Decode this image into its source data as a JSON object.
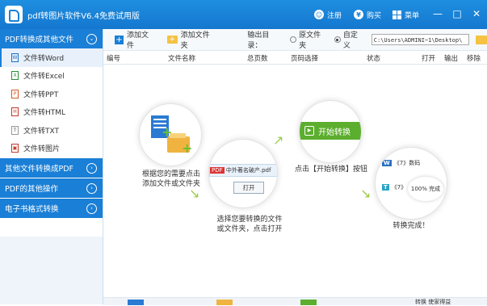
{
  "app": {
    "title": "pdf转图片软件V6.4免费试用版"
  },
  "titlebar": {
    "register": "注册",
    "buy": "购买",
    "menu": "菜单",
    "minimize": "—",
    "maximize": "□",
    "close": "✕"
  },
  "sidebar": {
    "section_title": "PDF转换成其他文件",
    "items": [
      {
        "label": "文件转Word",
        "icon": "W"
      },
      {
        "label": "文件转Excel",
        "icon": "X"
      },
      {
        "label": "文件转PPT",
        "icon": "P"
      },
      {
        "label": "文件转HTML",
        "icon": "H"
      },
      {
        "label": "文件转TXT",
        "icon": "T"
      },
      {
        "label": "文件转图片",
        "icon": "▣"
      }
    ],
    "categories": [
      "其他文件转换成PDF",
      "PDF的其他操作",
      "电子书格式转换"
    ]
  },
  "toolbar": {
    "add_file": "添加文件",
    "add_folder": "添加文件夹",
    "output_label": "输出目录：",
    "option_original": "原文件夹",
    "option_custom": "自定义",
    "path": "C:\\Users\\ADMINI~1\\Desktop\\"
  },
  "table": {
    "headers": [
      "编号",
      "文件名称",
      "总页数",
      "页码选择",
      "状态",
      "打开",
      "输出",
      "移除"
    ]
  },
  "guide": {
    "step1": "根据您的需要点击\n添加文件或文件夹",
    "step2": "选择您要转换的文件\n或文件夹，点击打开",
    "step3": "点击【开始转换】按钮",
    "step4": "转换完成！",
    "start_button": "开始转换",
    "pdf_file_label": "中外著名破产.pdf",
    "open_label": "打开",
    "result_line1": "《7》数码",
    "result_line2": "《7》",
    "progress": "100%",
    "done_label": "完成"
  },
  "bottom": {
    "partial_text": "转换 使家得益"
  }
}
